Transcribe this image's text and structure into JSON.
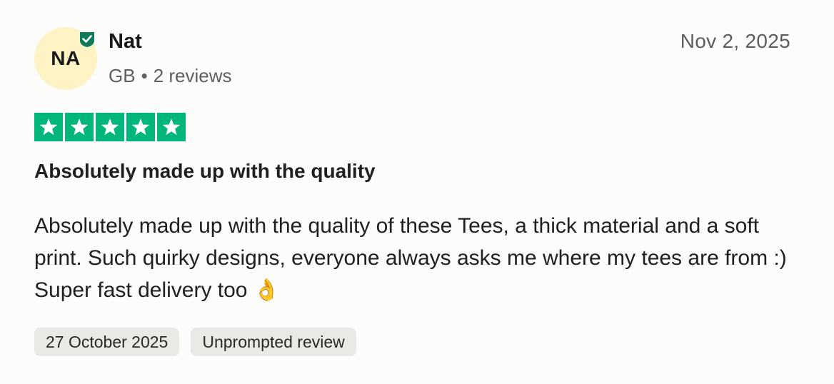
{
  "reviewer": {
    "initials": "NA",
    "name": "Nat",
    "country": "GB",
    "separator": "•",
    "reviews_count": "2 reviews",
    "avatar_color": "#fdf3c5",
    "verified_color": "#0f7a5c"
  },
  "review": {
    "date": "Nov 2, 2025",
    "rating": 5,
    "rating_max": 5,
    "star_color": "#00b67a",
    "title": "Absolutely made up with the quality",
    "body": "Absolutely made up with the quality of these Tees, a thick material and a soft print. Such quirky designs, everyone always asks me where my tees are from :) Super fast delivery too 👌"
  },
  "tags": [
    {
      "label": "27 October 2025"
    },
    {
      "label": "Unprompted review"
    }
  ]
}
